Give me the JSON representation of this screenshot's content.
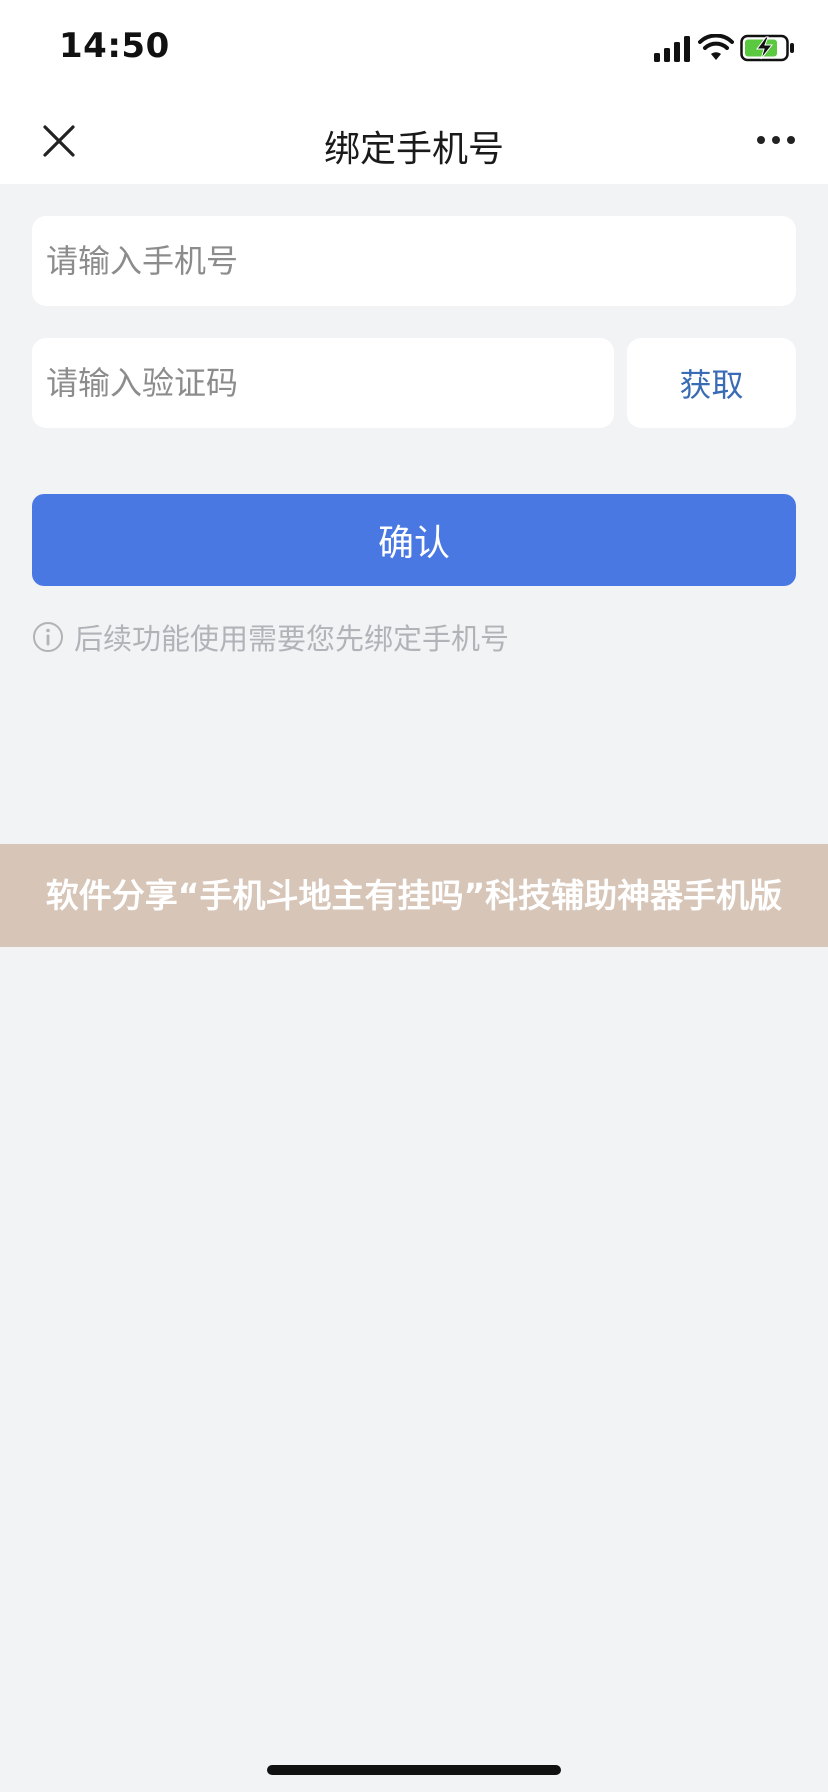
{
  "status_bar": {
    "time": "14:50",
    "icons": [
      "cellular-signal-icon",
      "wifi-icon",
      "battery-charging-icon"
    ]
  },
  "nav": {
    "title": "绑定手机号",
    "close_icon": "close-icon",
    "more_icon": "more-icon"
  },
  "form": {
    "phone_placeholder": "请输入手机号",
    "code_placeholder": "请输入验证码",
    "get_code_label": "获取",
    "confirm_label": "确认",
    "hint": "后续功能使用需要您先绑定手机号",
    "hint_icon": "info-icon"
  },
  "banner": {
    "text": "软件分享“手机斗地主有挂吗”科技辅助神器手机版"
  },
  "colors": {
    "primary": "#4a78e2",
    "link": "#3a6bb5",
    "background": "#f2f3f5",
    "banner": "#d7c5b8"
  }
}
